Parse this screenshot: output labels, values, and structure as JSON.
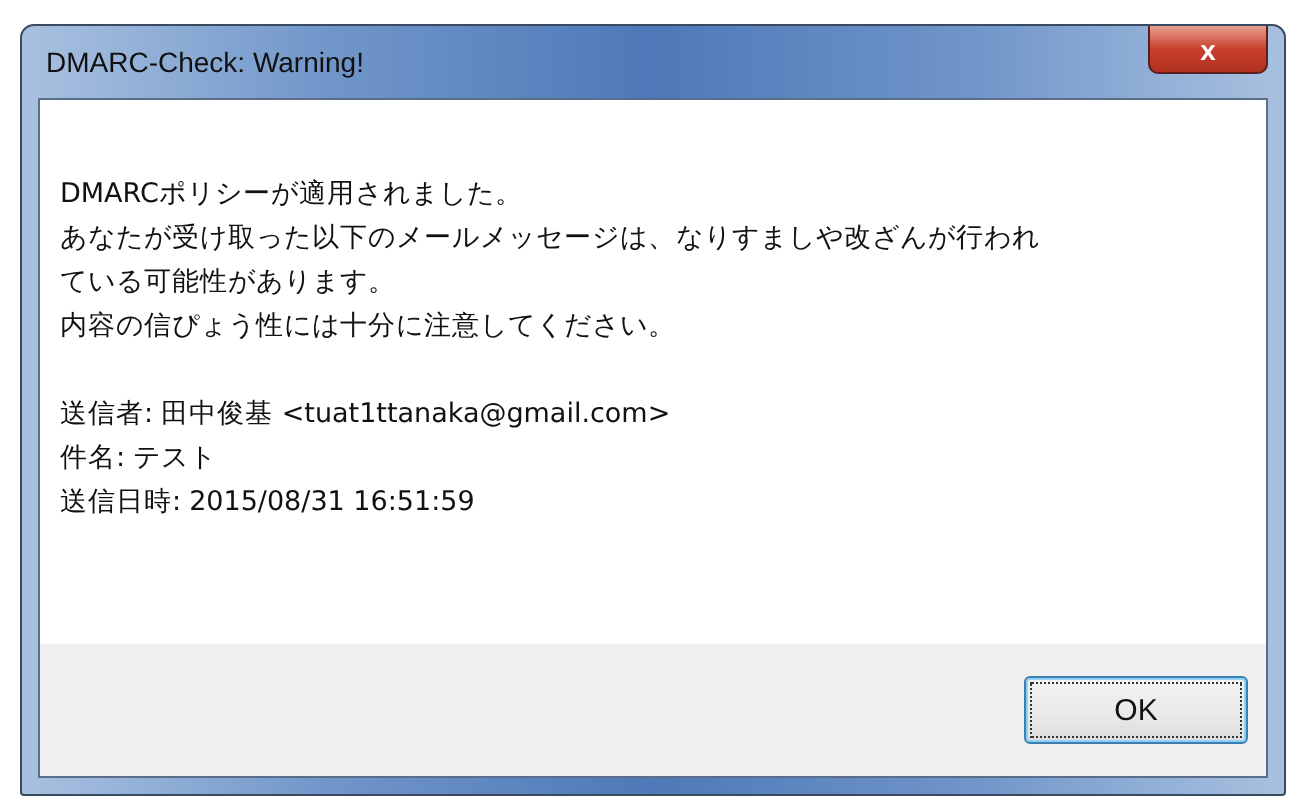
{
  "window": {
    "title": "DMARC-Check: Warning!",
    "close_label": "x"
  },
  "message_lines": [
    "DMARCポリシーが適用されました。",
    "あなたが受け取った以下のメールメッセージは、なりすましや改ざんが行われ",
    "ている可能性があります。",
    "内容の信ぴょう性には十分に注意してください。"
  ],
  "details": [
    {
      "label": "送信者:",
      "value": "田中俊基 <tuat1ttanaka@gmail.com>"
    },
    {
      "label": "件名:",
      "value": "テスト"
    },
    {
      "label": "送信日時:",
      "value": "2015/08/31 16:51:59"
    }
  ],
  "buttons": [
    {
      "label": "OK",
      "focused": true
    }
  ]
}
